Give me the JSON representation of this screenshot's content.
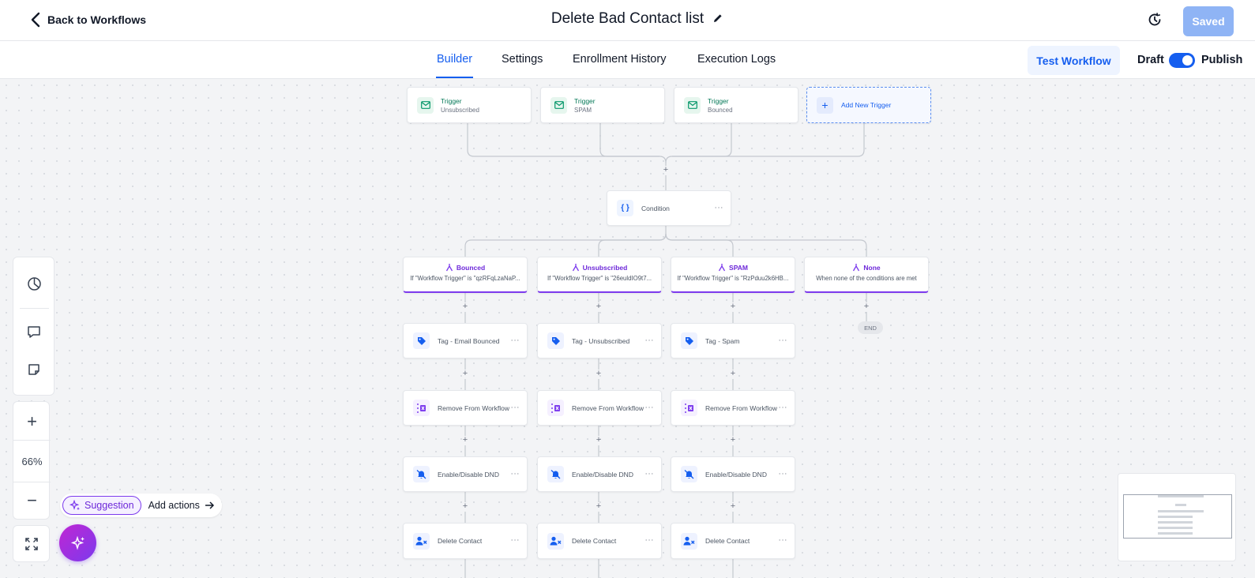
{
  "header": {
    "back_label": "Back to Workflows",
    "title": "Delete Bad Contact list",
    "saved_label": "Saved"
  },
  "tabs": [
    {
      "label": "Builder",
      "active": true
    },
    {
      "label": "Settings",
      "active": false
    },
    {
      "label": "Enrollment History",
      "active": false
    },
    {
      "label": "Execution Logs",
      "active": false
    }
  ],
  "toolbar": {
    "test_label": "Test Workflow",
    "draft_label": "Draft",
    "publish_label": "Publish",
    "publish_enabled": true
  },
  "triggers": [
    {
      "title": "Trigger",
      "subtitle": "Unsubscribed",
      "icon": "mail-icon"
    },
    {
      "title": "Trigger",
      "subtitle": "SPAM",
      "icon": "mail-icon"
    },
    {
      "title": "Trigger",
      "subtitle": "Bounced",
      "icon": "mail-icon"
    }
  ],
  "add_trigger_label": "Add New Trigger",
  "condition_label": "Condition",
  "branches": [
    {
      "name": "Bounced",
      "desc": "If \"Workflow Trigger\" is \"qzRFqLzaNaP..."
    },
    {
      "name": "Unsubscribed",
      "desc": "If \"Workflow Trigger\" is \"26euldIO9t7..."
    },
    {
      "name": "SPAM",
      "desc": "If \"Workflow Trigger\" is \"RzPduu2k6HB..."
    },
    {
      "name": "None",
      "desc": "When none of the conditions are met"
    }
  ],
  "actions": {
    "tag": [
      "Tag - Email Bounced",
      "Tag - Unsubscribed",
      "Tag - Spam"
    ],
    "remove": [
      "Remove From Workflow",
      "Remove From Workflow",
      "Remove From Workflow"
    ],
    "dnd": [
      "Enable/Disable DND",
      "Enable/Disable DND",
      "Enable/Disable DND"
    ],
    "delete": [
      "Delete Contact",
      "Delete Contact",
      "Delete Contact"
    ]
  },
  "end_label": "END",
  "zoom": {
    "level": "66%"
  },
  "suggestion": {
    "chip_label": "Suggestion",
    "add_label": "Add actions"
  },
  "colors": {
    "accent": "#155eef",
    "branch": "#7c3aed",
    "trigger": "#047857"
  }
}
